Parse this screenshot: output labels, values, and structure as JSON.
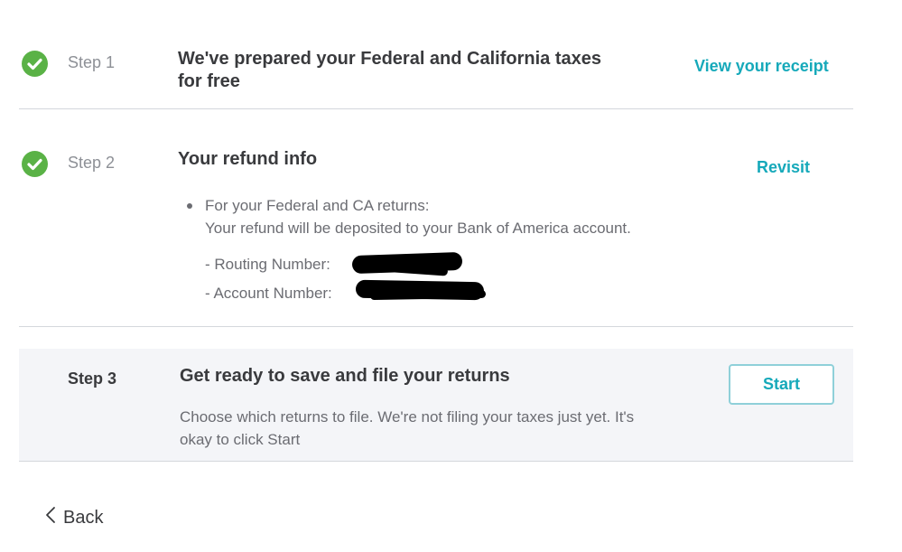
{
  "steps": [
    {
      "label": "Step 1",
      "title_line1": "We've prepared your Federal and California taxes",
      "title_line2": "for free",
      "action": "View your receipt",
      "status_icon": "check-circle-icon"
    },
    {
      "label": "Step 2",
      "title": "Your refund info",
      "action": "Revisit",
      "status_icon": "check-circle-icon",
      "bullet_line1": "For your Federal and CA returns:",
      "bullet_line2": "Your refund will be deposited to your Bank of America account.",
      "routing_label": "- Routing Number:",
      "account_label": "- Account Number:"
    },
    {
      "label": "Step 3",
      "title": "Get ready to save and file your returns",
      "desc_line1": "Choose which returns to file. We're not filing your taxes just yet. It's",
      "desc_line2": "okay to click Start",
      "action": "Start"
    }
  ],
  "nav": {
    "back_label": "Back",
    "back_icon": "chevron-left-icon"
  },
  "colors": {
    "accent": "#16a9ba",
    "success": "#5ab246",
    "panel": "#f4f5f8"
  }
}
